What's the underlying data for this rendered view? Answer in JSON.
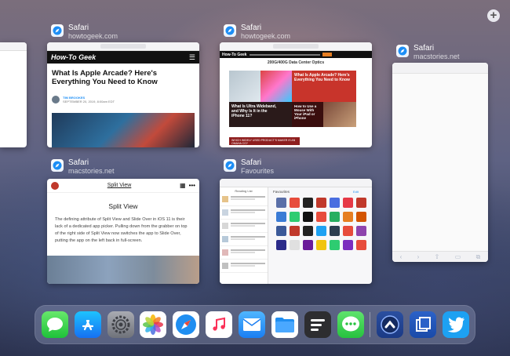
{
  "add_space_label": "+",
  "cards": [
    {
      "app": "Safari",
      "site": "howtogeek.com"
    },
    {
      "app": "Safari",
      "site": "howtogeek.com"
    },
    {
      "app": "Safari",
      "site": "macstories.net"
    },
    {
      "app": "Safari",
      "site": "macstories.net"
    },
    {
      "app": "Safari",
      "site": "Favourites"
    }
  ],
  "htg": {
    "logo": "How-To Geek",
    "headline": "What Is Apple Arcade? Here's Everything You Need to Know",
    "author": "TIM BROOKES",
    "date": "SEPTEMBER 20, 2019, 8:00am EDT"
  },
  "htg2": {
    "logo": "How-To Geek",
    "ad": "200G/400G Data Center Optics",
    "story1": "What Is Apple Arcade? Here's Everything You Need to Know",
    "story2": "What Is Ultra Wideband, and Why Is It in the iPhone 11?",
    "story3": "How to Use a Mouse With Your iPad or iPhone",
    "footer": "WHICH WIDELY USED PRODUCT'S MAKER IS AN OMAHA CO?"
  },
  "ms": {
    "nav_title": "Split View",
    "title": "Split View",
    "body": "The defining attribute of Split View and Slide Over in iOS 11 is their lack of a dedicated app picker. Pulling down from the grabber on top of the right side of Split View now switches the app to Slide Over, putting the app on the left back in full-screen."
  },
  "fav": {
    "sidebar_title": "Reading List",
    "header": "Favourites",
    "edit": "Edit"
  },
  "dock_icons": [
    "Messages",
    "App Store",
    "Settings",
    "Photos",
    "Safari",
    "Music",
    "Mail",
    "Files",
    "Notes",
    "WhatsApp",
    "Screens",
    "Scanner",
    "Twitter"
  ],
  "colors": {
    "accent": "#1c8ef6",
    "htg_black": "#111111",
    "htg_red": "#c0392b"
  }
}
